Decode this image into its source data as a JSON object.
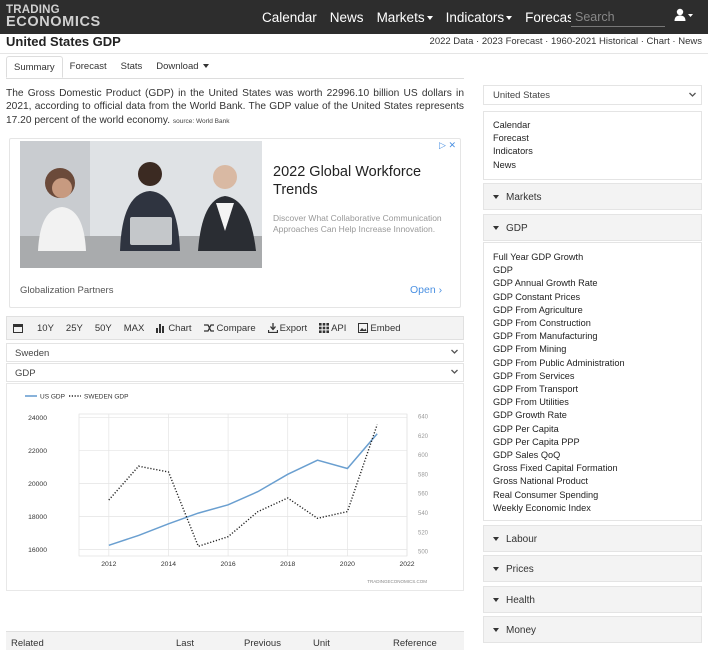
{
  "nav": {
    "logo_line1": "TRADING",
    "logo_line2": "ECONOMICS",
    "links": [
      "Calendar",
      "News",
      "Markets",
      "Indicators",
      "Forecasts"
    ],
    "search_placeholder": "Search"
  },
  "title": "United States GDP",
  "title_links": "2022 Data · 2023 Forecast · 1960-2021 Historical · Chart · News",
  "tabs": [
    "Summary",
    "Forecast",
    "Stats",
    "Download"
  ],
  "intro": {
    "text": "The Gross Domestic Product (GDP) in the United States was worth 22996.10 billion US dollars in 2021, according to official data from the World Bank. The GDP value of the United States represents 17.20 percent of the world economy.",
    "source": "source: World Bank"
  },
  "ad": {
    "title": "2022 Global Workforce Trends",
    "description": "Discover What Collaborative Communication Approaches Can Help Increase Innovation.",
    "advertiser": "Globalization Partners",
    "cta": "Open"
  },
  "toolbar": {
    "ranges": [
      "10Y",
      "25Y",
      "50Y",
      "MAX"
    ],
    "chart": "Chart",
    "compare": "Compare",
    "export": "Export",
    "api": "API",
    "embed": "Embed"
  },
  "compare_country": "Sweden",
  "compare_indicator": "GDP",
  "chart_data": {
    "type": "line",
    "series": [
      {
        "name": "US GDP",
        "axis": "left",
        "color": "#6a9fd0",
        "style": "solid",
        "x": [
          2012,
          2013,
          2014,
          2015,
          2016,
          2017,
          2018,
          2019,
          2020,
          2021
        ],
        "values": [
          16250,
          16850,
          17550,
          18200,
          18700,
          19500,
          20550,
          21400,
          20900,
          23000
        ]
      },
      {
        "name": "SWEDEN GDP",
        "axis": "right",
        "color": "#222222",
        "style": "dotted",
        "x": [
          2012,
          2013,
          2014,
          2015,
          2016,
          2017,
          2018,
          2019,
          2020,
          2021
        ],
        "values": [
          553,
          588,
          582,
          505,
          515,
          541,
          555,
          534,
          541,
          631
        ]
      }
    ],
    "x_ticks": [
      2012,
      2014,
      2016,
      2018,
      2020,
      2022
    ],
    "y_left_ticks": [
      16000,
      18000,
      20000,
      22000,
      24000
    ],
    "y_right_ticks": [
      500,
      520,
      540,
      560,
      580,
      600,
      620,
      640
    ],
    "xlim": [
      2011,
      2022
    ],
    "ylim_left": [
      15600,
      24200
    ],
    "ylim_right": [
      495,
      642
    ],
    "grid": true,
    "legend": "top-left",
    "watermark": "TRADINGECONOMICS.COM"
  },
  "related_headers": [
    "Related",
    "Last",
    "Previous",
    "Unit",
    "Reference"
  ],
  "sidebar": {
    "country": "United States",
    "links": [
      "Calendar",
      "Forecast",
      "Indicators",
      "News"
    ],
    "markets_label": "Markets",
    "gdp_label": "GDP",
    "gdp_items": [
      "Full Year GDP Growth",
      "GDP",
      "GDP Annual Growth Rate",
      "GDP Constant Prices",
      "GDP From Agriculture",
      "GDP From Construction",
      "GDP From Manufacturing",
      "GDP From Mining",
      "GDP From Public Administration",
      "GDP From Services",
      "GDP From Transport",
      "GDP From Utilities",
      "GDP Growth Rate",
      "GDP Per Capita",
      "GDP Per Capita PPP",
      "GDP Sales QoQ",
      "Gross Fixed Capital Formation",
      "Gross National Product",
      "Real Consumer Spending",
      "Weekly Economic Index"
    ],
    "sections": [
      "Labour",
      "Prices",
      "Health",
      "Money"
    ]
  }
}
